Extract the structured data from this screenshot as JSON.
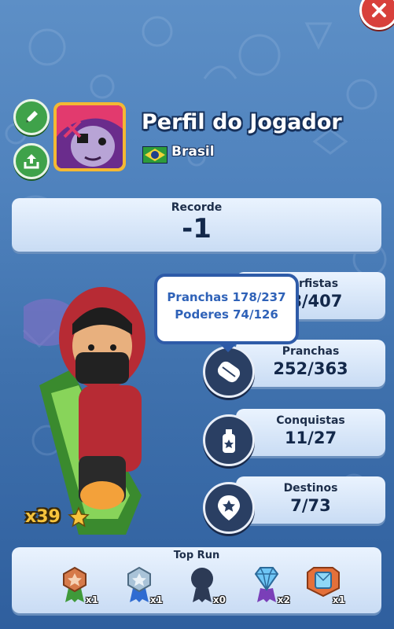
{
  "profile": {
    "title": "Perfil do Jogador",
    "country": "Brasil"
  },
  "record": {
    "label": "Recorde",
    "value": "-1"
  },
  "tooltip": {
    "line1": "Pranchas 178/237",
    "line2": "Poderes 74/126"
  },
  "stats": [
    {
      "label": "Surfistas",
      "value": "38/407",
      "icon": "character-silhouette-icon"
    },
    {
      "label": "Pranchas",
      "value": "252/363",
      "icon": "hoverboard-icon"
    },
    {
      "label": "Conquistas",
      "value": "11/27",
      "icon": "spray-can-icon"
    },
    {
      "label": "Destinos",
      "value": "7/73",
      "icon": "map-pin-star-icon"
    }
  ],
  "multiplier": "x39",
  "top_run": {
    "label": "Top Run",
    "medals": [
      {
        "name": "bronze-medal-icon",
        "count": "x1",
        "color": "#d67a4a"
      },
      {
        "name": "silver-medal-icon",
        "count": "x1",
        "color": "#a9c3d8"
      },
      {
        "name": "locked-medal-icon",
        "count": "x0",
        "color": "#2c3a55"
      },
      {
        "name": "diamond-medal-icon",
        "count": "x2",
        "color": "#6fc6f6"
      },
      {
        "name": "legendary-medal-icon",
        "count": "x1",
        "color": "#e4703a"
      }
    ]
  },
  "colors": {
    "background": "#4f82bd",
    "panel": "#dce9fb",
    "accent_green": "#3fa24a",
    "close_red": "#d8403b",
    "gold": "#f4b833"
  }
}
